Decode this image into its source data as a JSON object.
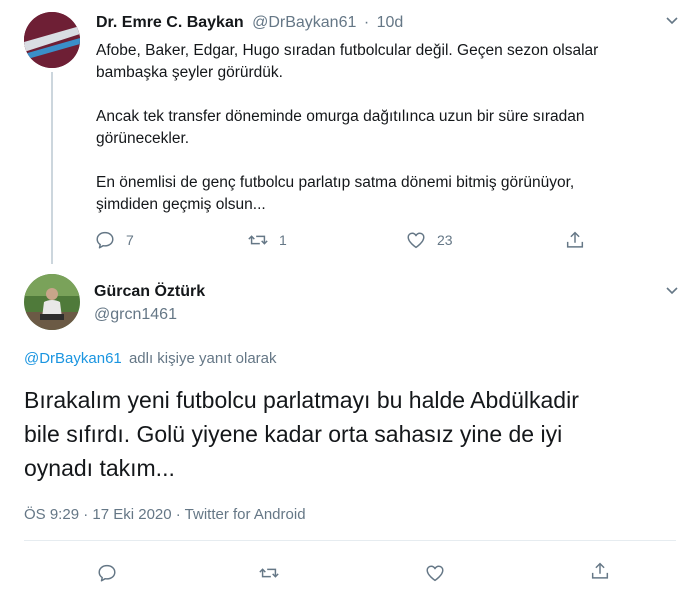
{
  "parent_tweet": {
    "author_name": "Dr. Emre C. Baykan",
    "author_handle": "@DrBaykan61",
    "separator": "·",
    "time_ago": "10d",
    "paragraphs": [
      [
        "Afobe, Baker, Edgar, Hugo sıradan futbolcular değil. Geçen sezon olsalar",
        "bambaşka şeyler görürdük."
      ],
      [
        "Ancak tek transfer döneminde omurga dağıtılınca uzun bir süre sıradan",
        "görünecekler."
      ],
      [
        "En önemlisi de genç futbolcu parlatıp satma dönemi bitmiş görünüyor,",
        "şimdiden geçmiş olsun..."
      ]
    ],
    "reply_count": "7",
    "retweet_count": "1",
    "like_count": "23"
  },
  "main_tweet": {
    "author_name": "Gürcan Öztürk",
    "author_handle": "@grcn1461",
    "reply_to_handle": "@DrBaykan61",
    "reply_to_suffix": "adlı kişiye yanıt olarak",
    "text_lines": [
      "Bırakalım yeni futbolcu parlatmayı bu halde Abdülkadir",
      "bile sıfırdı. Golü yiyene kadar orta sahasız yine de iyi",
      "oynadı takım..."
    ],
    "timestamp": "ÖS 9:29 · 17 Eki 2020 · Twitter for Android"
  },
  "icons": {
    "reply": "reply-icon",
    "retweet": "retweet-icon",
    "like": "heart-icon",
    "share": "share-icon",
    "more": "chevron-down-icon"
  },
  "colors": {
    "link": "#1b95e0",
    "secondary_text": "#657786",
    "thread_line": "#ccd6dd"
  }
}
